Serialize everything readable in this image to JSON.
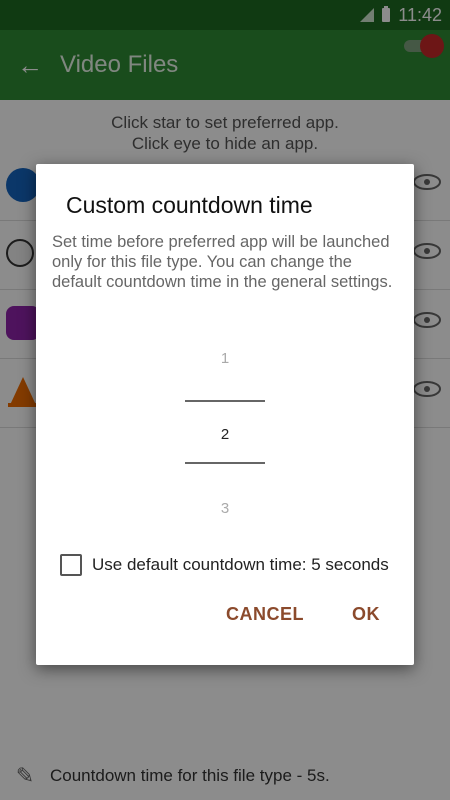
{
  "status_bar": {
    "time": "11:42"
  },
  "app_bar": {
    "title": "Video Files"
  },
  "content": {
    "hint_line1": "Click star to set preferred app.",
    "hint_line2": "Click eye to hide an app.",
    "app_rows": [
      {
        "icon": "gif-app-icon",
        "color": "#1565c0"
      },
      {
        "icon": "info-app-icon",
        "color": "#eeeeee"
      },
      {
        "icon": "video-player-icon",
        "color": "#8e24aa"
      },
      {
        "icon": "vlc-cone-icon",
        "color": "#ef6c00"
      }
    ]
  },
  "footer": {
    "text": "Countdown time for this file type - 5s."
  },
  "dialog": {
    "title": "Custom countdown time",
    "message": "Set time before preferred app will be launched only for this file type. You can change the default countdown time in the general settings.",
    "picker": {
      "prev": "1",
      "selected": "2",
      "next": "3"
    },
    "checkbox_label": "Use default countdown time: 5 seconds",
    "checkbox_checked": false,
    "cancel_label": "CANCEL",
    "ok_label": "OK"
  },
  "colors": {
    "status_bar": "#1e6b22",
    "app_bar": "#2e8b34",
    "button_text": "#8b4a2c"
  }
}
